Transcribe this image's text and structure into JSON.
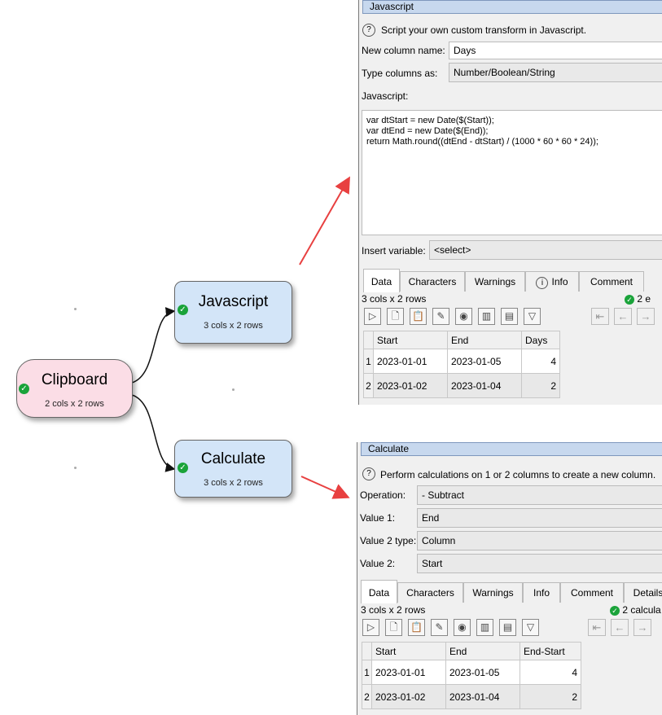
{
  "nodes": {
    "clipboard": {
      "title": "Clipboard",
      "subtitle": "2 cols x 2 rows",
      "color": "#fbdde6"
    },
    "javascript": {
      "title": "Javascript",
      "subtitle": "3 cols x 2 rows",
      "color": "#d3e5f8"
    },
    "calculate": {
      "title": "Calculate",
      "subtitle": "3 cols x 2 rows",
      "color": "#d3e5f8"
    }
  },
  "js_panel": {
    "title": "Javascript",
    "description": "Script your own custom transform in Javascript.",
    "new_column_label": "New column name:",
    "new_column_value": "Days",
    "type_label": "Type columns as:",
    "type_value": "Number/Boolean/String",
    "javascript_label": "Javascript:",
    "code": "var dtStart = new Date($(Start));\nvar dtEnd = new Date($(End));\nreturn Math.round((dtEnd - dtStart) / (1000 * 60 * 60 * 24));",
    "insert_label": "Insert variable:",
    "insert_value": "<select>",
    "tabs": [
      "Data",
      "Characters",
      "Warnings",
      "Info",
      "Comment"
    ],
    "summary": "3 cols x 2 rows",
    "status": "2 e",
    "columns": [
      "Start",
      "End",
      "Days"
    ],
    "rows": [
      {
        "n": "1",
        "start": "2023-01-01",
        "end": "2023-01-05",
        "val": "4"
      },
      {
        "n": "2",
        "start": "2023-01-02",
        "end": "2023-01-04",
        "val": "2"
      }
    ]
  },
  "calc_panel": {
    "title": "Calculate",
    "description": "Perform calculations on 1 or 2 columns to create a new column.",
    "operation_label": "Operation:",
    "operation_value": "- Subtract",
    "value1_label": "Value 1:",
    "value1_value": "End",
    "value2type_label": "Value 2 type:",
    "value2type_value": "Column",
    "value2_label": "Value 2:",
    "value2_value": "Start",
    "tabs": [
      "Data",
      "Characters",
      "Warnings",
      "Info",
      "Comment",
      "Details"
    ],
    "summary": "3 cols x 2 rows",
    "status": "2 calcula",
    "columns": [
      "Start",
      "End",
      "End-Start"
    ],
    "rows": [
      {
        "n": "1",
        "start": "2023-01-01",
        "end": "2023-01-05",
        "val": "4"
      },
      {
        "n": "2",
        "start": "2023-01-02",
        "end": "2023-01-04",
        "val": "2"
      }
    ]
  },
  "colors": {
    "arrow": "#e84040",
    "title_bar": "#c7d8ee",
    "ok_green": "#1aa33a"
  },
  "icons": [
    "help-icon",
    "run-icon",
    "new-icon",
    "clipboard-icon",
    "edit-icon",
    "eye-icon",
    "columns-icon",
    "rows-icon",
    "filter-icon",
    "first-icon",
    "prev-icon",
    "next-icon",
    "check-icon"
  ]
}
